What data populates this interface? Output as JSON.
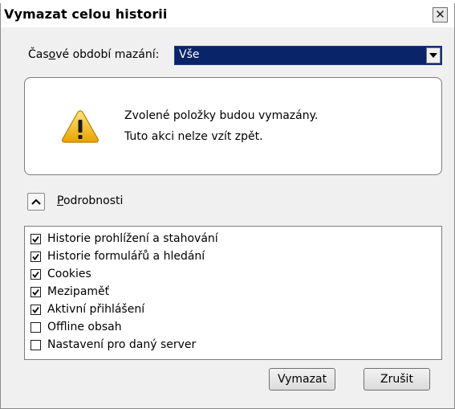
{
  "window": {
    "title": "Vymazat celou historii",
    "close_label": "✕"
  },
  "period": {
    "label_prefix": "Čas",
    "label_accel": "o",
    "label_suffix": "vé období mazání:",
    "value": "Vše"
  },
  "warning": {
    "line1": "Zvolené položky budou vymazány.",
    "line2": "Tuto akci nelze vzít zpět."
  },
  "details": {
    "label_accel": "P",
    "label_rest": "odrobnosti",
    "expanded": true
  },
  "items": [
    {
      "label": "Historie prohlížení a stahování",
      "checked": true
    },
    {
      "label": "Historie formulářů a hledání",
      "checked": true
    },
    {
      "label": "Cookies",
      "checked": true
    },
    {
      "label": "Mezipaměť",
      "checked": true
    },
    {
      "label": "Aktivní přihlášení",
      "checked": true
    },
    {
      "label": "Offline obsah",
      "checked": false
    },
    {
      "label": "Nastavení pro daný server",
      "checked": false
    }
  ],
  "buttons": {
    "clear": "Vymazat",
    "cancel": "Zrušit"
  },
  "colors": {
    "select_highlight": "#0a246a",
    "dialog_bg": "#f0f0f0",
    "warning_yellow": "#f5c518"
  }
}
